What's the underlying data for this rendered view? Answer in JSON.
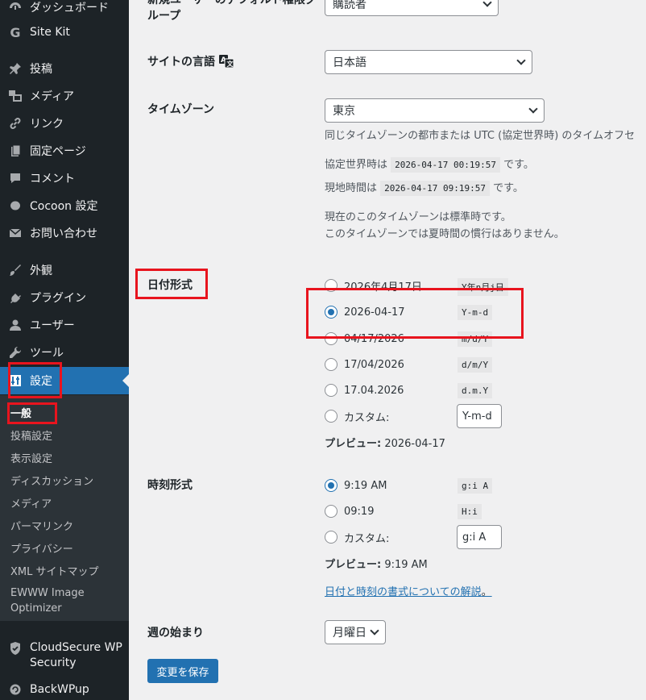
{
  "sidebar": {
    "items": [
      {
        "label": "ダッシュボード",
        "icon": "dashboard-icon"
      },
      {
        "label": "Site Kit",
        "icon": "google-g-icon"
      },
      {
        "label": "投稿",
        "icon": "pin-icon"
      },
      {
        "label": "メディア",
        "icon": "media-icon"
      },
      {
        "label": "リンク",
        "icon": "link-icon"
      },
      {
        "label": "固定ページ",
        "icon": "page-icon"
      },
      {
        "label": "コメント",
        "icon": "comment-icon"
      },
      {
        "label": "Cocoon 設定",
        "icon": "circle-icon"
      },
      {
        "label": "お問い合わせ",
        "icon": "mail-icon"
      },
      {
        "label": "外観",
        "icon": "brush-icon"
      },
      {
        "label": "プラグイン",
        "icon": "plugin-icon"
      },
      {
        "label": "ユーザー",
        "icon": "user-icon"
      },
      {
        "label": "ツール",
        "icon": "wrench-icon"
      },
      {
        "label": "設定",
        "icon": "settings-icon"
      },
      {
        "label": "CloudSecure WP Security",
        "icon": "shield-icon"
      },
      {
        "label": "BackWPup",
        "icon": "backup-icon"
      }
    ],
    "submenu": [
      "一般",
      "投稿設定",
      "表示設定",
      "ディスカッション",
      "メディア",
      "パーマリンク",
      "プライバシー",
      "XML サイトマップ",
      "EWWW Image Optimizer"
    ]
  },
  "settings": {
    "default_role": {
      "label": "新規ユーザーのデフォルト権限グループ",
      "value": "購読者"
    },
    "language": {
      "label": "サイトの言語",
      "value": "日本語"
    },
    "timezone": {
      "label": "タイムゾーン",
      "value": "東京",
      "description": "同じタイムゾーンの都市または UTC (協定世界時) のタイムオフセ",
      "utc_prefix": "協定世界時は",
      "utc_time": "2026-04-17 00:19:57",
      "utc_suffix": "です。",
      "local_prefix": "現地時間は",
      "local_time": "2026-04-17 09:19:57",
      "local_suffix": "です。",
      "std_note": "現在のこのタイムゾーンは標準時です。",
      "dst_note": "このタイムゾーンでは夏時間の慣行はありません。"
    },
    "date_format": {
      "label": "日付形式",
      "options": [
        {
          "label": "2026年4月17日",
          "code": "Y年n月j日",
          "checked": false
        },
        {
          "label": "2026-04-17",
          "code": "Y-m-d",
          "checked": true
        },
        {
          "label": "04/17/2026",
          "code": "m/d/Y",
          "checked": false
        },
        {
          "label": "17/04/2026",
          "code": "d/m/Y",
          "checked": false
        },
        {
          "label": "17.04.2026",
          "code": "d.m.Y",
          "checked": false
        }
      ],
      "custom_label": "カスタム:",
      "custom_value": "Y-m-d",
      "preview_label": "プレビュー:",
      "preview_value": "2026-04-17"
    },
    "time_format": {
      "label": "時刻形式",
      "options": [
        {
          "label": "9:19 AM",
          "code": "g:i A",
          "checked": true
        },
        {
          "label": "09:19",
          "code": "H:i",
          "checked": false
        }
      ],
      "custom_label": "カスタム:",
      "custom_value": "g:i A",
      "preview_label": "プレビュー:",
      "preview_value": "9:19 AM",
      "doc_link": "日付と時刻の書式についての解説",
      "doc_link_tail": "。"
    },
    "week_start": {
      "label": "週の始まり",
      "value": "月曜日"
    },
    "save_button": "変更を保存"
  },
  "colors": {
    "sidebar_bg": "#1d2327",
    "submenu_bg": "#2c3338",
    "accent": "#2271b1",
    "annotation": "#e8141e"
  }
}
